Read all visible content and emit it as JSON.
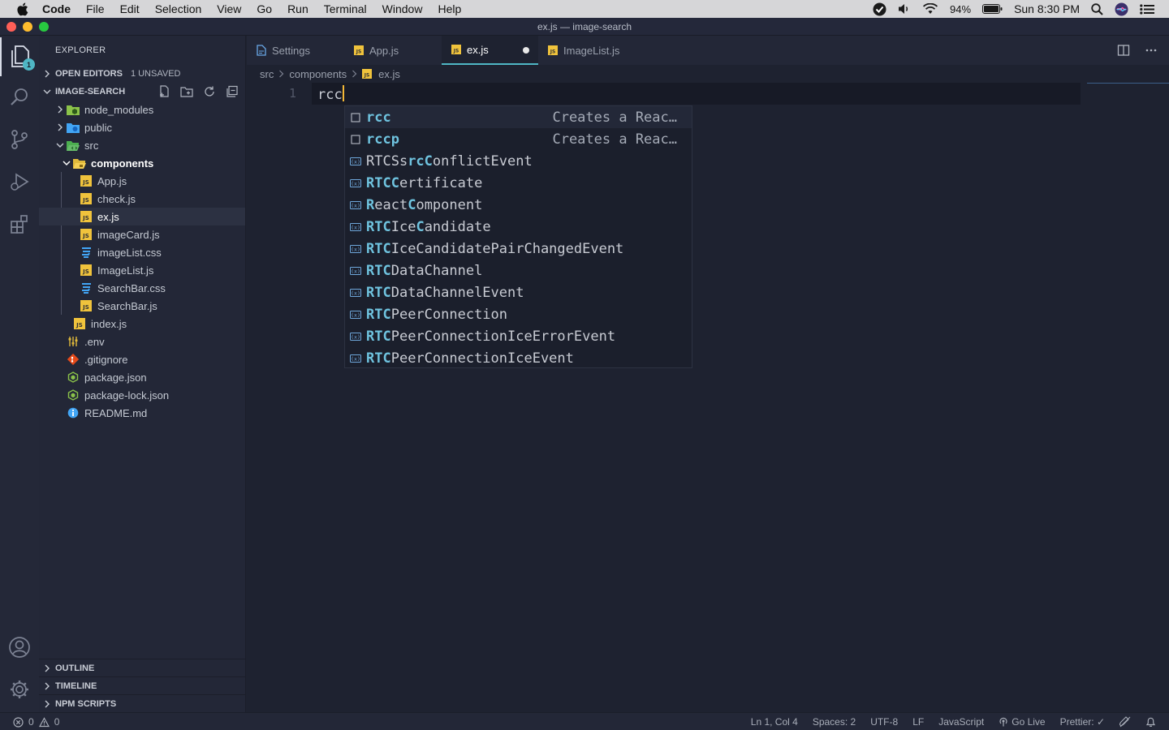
{
  "menubar": {
    "items": [
      "Code",
      "File",
      "Edit",
      "Selection",
      "View",
      "Go",
      "Run",
      "Terminal",
      "Window",
      "Help"
    ],
    "battery": "94%",
    "clock": "Sun 8:30 PM"
  },
  "window": {
    "title": "ex.js — image-search"
  },
  "activity": {
    "explorer_badge": "1"
  },
  "sidebar": {
    "title": "EXPLORER",
    "open_editors": "OPEN EDITORS",
    "unsaved": "1 UNSAVED",
    "project": "IMAGE-SEARCH",
    "tree": [
      {
        "name": "node_modules",
        "type": "folder-node"
      },
      {
        "name": "public",
        "type": "folder-public"
      },
      {
        "name": "src",
        "type": "folder-src"
      },
      {
        "name": "components",
        "type": "folder-components"
      },
      {
        "name": "App.js",
        "type": "js"
      },
      {
        "name": "check.js",
        "type": "js"
      },
      {
        "name": "ex.js",
        "type": "js"
      },
      {
        "name": "imageCard.js",
        "type": "js"
      },
      {
        "name": "imageList.css",
        "type": "css"
      },
      {
        "name": "ImageList.js",
        "type": "js"
      },
      {
        "name": "SearchBar.css",
        "type": "css"
      },
      {
        "name": "SearchBar.js",
        "type": "js"
      },
      {
        "name": "index.js",
        "type": "js"
      },
      {
        "name": ".env",
        "type": "env"
      },
      {
        "name": ".gitignore",
        "type": "git"
      },
      {
        "name": "package.json",
        "type": "npm"
      },
      {
        "name": "package-lock.json",
        "type": "npm"
      },
      {
        "name": "README.md",
        "type": "info"
      }
    ],
    "outline": "OUTLINE",
    "timeline": "TIMELINE",
    "npm_scripts": "NPM SCRIPTS"
  },
  "tabs": [
    {
      "label": "Settings"
    },
    {
      "label": "App.js"
    },
    {
      "label": "ex.js"
    },
    {
      "label": "ImageList.js"
    }
  ],
  "breadcrumbs": [
    "src",
    "components",
    "ex.js"
  ],
  "editor": {
    "line_number": "1",
    "code": "rcc"
  },
  "suggest": [
    {
      "kind": "snippet",
      "pre": "",
      "hl": "rcc",
      "post": "",
      "detail": "Creates a Reac…"
    },
    {
      "kind": "snippet",
      "pre": "",
      "hl": "rccp",
      "post": "",
      "detail": "Creates a Reac…"
    },
    {
      "kind": "variable",
      "pre": "RTCSs",
      "hl": "rcC",
      "post": "onflictEvent",
      "detail": ""
    },
    {
      "kind": "variable",
      "pre": "",
      "hl": "RTCC",
      "post": "ertificate",
      "detail": ""
    },
    {
      "kind": "variable",
      "pre": "",
      "hl": "R",
      "post": "eact",
      "hl2": "C",
      "post2": "omponent",
      "detail": ""
    },
    {
      "kind": "variable",
      "pre": "",
      "hl": "RTC",
      "post": "Ice",
      "hl2": "C",
      "post2": "andidate",
      "detail": ""
    },
    {
      "kind": "variable",
      "pre": "",
      "hl": "RTC",
      "post": "IceCandidatePairChangedEvent",
      "detail": ""
    },
    {
      "kind": "variable",
      "pre": "",
      "hl": "RTC",
      "post": "DataChannel",
      "detail": ""
    },
    {
      "kind": "variable",
      "pre": "",
      "hl": "RTC",
      "post": "DataChannelEvent",
      "detail": ""
    },
    {
      "kind": "variable",
      "pre": "",
      "hl": "RTC",
      "post": "PeerConnection",
      "detail": ""
    },
    {
      "kind": "variable",
      "pre": "",
      "hl": "RTC",
      "post": "PeerConnectionIceErrorEvent",
      "detail": ""
    },
    {
      "kind": "variable",
      "pre": "",
      "hl": "RTC",
      "post": "PeerConnectionIceEvent",
      "detail": ""
    }
  ],
  "status": {
    "errors": "0",
    "warnings": "0",
    "position": "Ln 1, Col 4",
    "spaces": "Spaces: 2",
    "encoding": "UTF-8",
    "eol": "LF",
    "language": "JavaScript",
    "go_live": "Go Live",
    "prettier": "Prettier: ✓"
  },
  "colors": {
    "accent": "#4fb6c4",
    "cursor": "#f3b736",
    "js_icon": "#f0c33c",
    "css_icon": "#42a5f5"
  }
}
